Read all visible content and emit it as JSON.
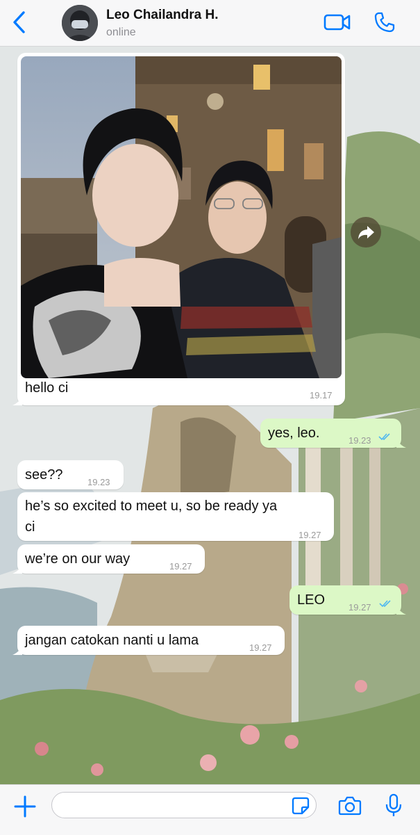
{
  "header": {
    "contact_name": "Leo Chailandra H.",
    "status": "online"
  },
  "messages": [
    {
      "direction": "incoming",
      "type": "photo",
      "text": "hello ci",
      "time": "19.17"
    },
    {
      "direction": "outgoing",
      "text": "yes, leo.",
      "time": "19.23",
      "receipt": "double-check-read-icon"
    },
    {
      "direction": "incoming",
      "text": "see??",
      "time": "19.23"
    },
    {
      "direction": "incoming",
      "text_line1": "he’s so excited to meet u, so be ready ya",
      "text_line2": "ci",
      "time": "19.27"
    },
    {
      "direction": "incoming",
      "text": "we’re on our way",
      "time": "19.27"
    },
    {
      "direction": "outgoing",
      "text": "LEO",
      "time": "19.27",
      "receipt": "double-check-read-icon"
    },
    {
      "direction": "incoming",
      "text": "jangan catokan nanti u lama",
      "time": "19.27"
    }
  ],
  "input": {
    "value": "",
    "placeholder": ""
  },
  "colors": {
    "accent": "#007aff",
    "outgoing_bubble": "#dcf8c6",
    "incoming_bubble": "#ffffff",
    "read_receipt": "#4fb8f0"
  }
}
